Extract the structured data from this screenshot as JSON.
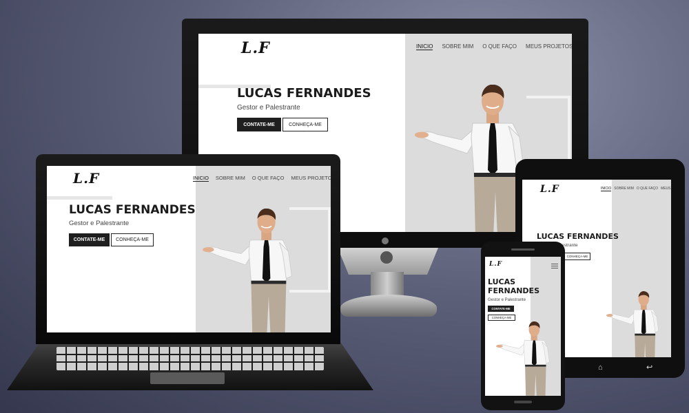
{
  "site": {
    "logo": "L.F",
    "nav": [
      "INICIO",
      "SOBRE MIM",
      "O QUE FAÇO",
      "MEUS PROJETOS"
    ],
    "name": "LUCAS FERNANDES",
    "name_line1": "LUCAS",
    "name_line2": "FERNANDES",
    "subtitle": "Gestor e Palestrante",
    "cta_primary": "CONTATE-ME",
    "cta_secondary": "CONHEÇA-ME"
  },
  "colors": {
    "background": "#4b4f66",
    "hero_panel": "#dcdcdc",
    "button_dark": "#1f1f1f",
    "shirt": "#ffffff",
    "tie": "#111111",
    "pants": "#b8aa98"
  },
  "icons": [
    "menu-icon",
    "home-icon",
    "back-icon"
  ]
}
